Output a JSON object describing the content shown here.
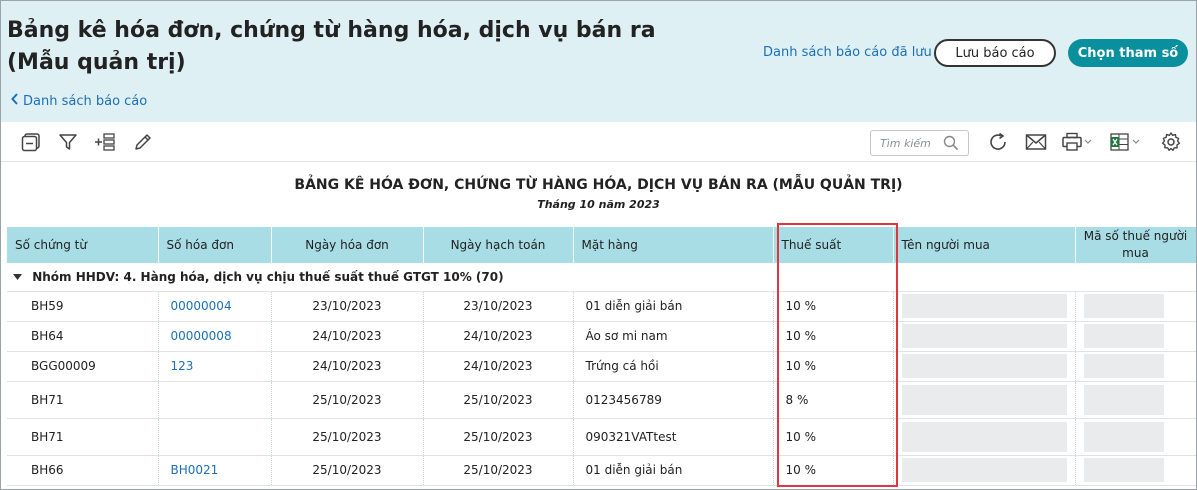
{
  "header": {
    "title_line1": "Bảng kê hóa đơn, chứng từ hàng hóa, dịch vụ bán ra",
    "title_line2": "(Mẫu quản trị)",
    "back_link": "Danh sách báo cáo",
    "saved_reports_link": "Danh sách báo cáo đã lưu",
    "save_button": "Lưu báo cáo",
    "params_button": "Chọn tham số"
  },
  "toolbar": {
    "search_placeholder": "Tìm kiếm",
    "icons": [
      "collapse-icon",
      "filter-icon",
      "add-row-icon",
      "edit-icon",
      "refresh-icon",
      "mail-icon",
      "print-icon",
      "excel-icon",
      "settings-icon"
    ]
  },
  "report": {
    "title": "BẢNG KÊ HÓA ĐƠN, CHỨNG TỪ HÀNG HÓA, DỊCH VỤ BÁN RA (MẪU QUẢN TRỊ)",
    "subtitle": "Tháng 10 năm 2023"
  },
  "table": {
    "columns": [
      "Số chứng từ",
      "Số hóa đơn",
      "Ngày hóa đơn",
      "Ngày hạch toán",
      "Mặt hàng",
      "Thuế suất",
      "Tên người mua",
      "Mã số thuế người mua"
    ],
    "group_label": "Nhóm HHDV: 4. Hàng hóa, dịch vụ chịu thuế suất thuế GTGT 10% (70)",
    "rows": [
      {
        "so_chung_tu": "BH59",
        "so_hoa_don": "00000004",
        "ngay_hoa_don": "23/10/2023",
        "ngay_hach_toan": "23/10/2023",
        "mat_hang": "01 diễn giải bán",
        "thue_suat": "10 %"
      },
      {
        "so_chung_tu": "BH64",
        "so_hoa_don": "00000008",
        "ngay_hoa_don": "24/10/2023",
        "ngay_hach_toan": "24/10/2023",
        "mat_hang": "Áo sơ mi nam",
        "thue_suat": "10 %"
      },
      {
        "so_chung_tu": "BGG00009",
        "so_hoa_don": "123",
        "ngay_hoa_don": "24/10/2023",
        "ngay_hach_toan": "24/10/2023",
        "mat_hang": "Trứng cá hồi",
        "thue_suat": "10 %"
      },
      {
        "so_chung_tu": "BH71",
        "so_hoa_don": "",
        "ngay_hoa_don": "25/10/2023",
        "ngay_hach_toan": "25/10/2023",
        "mat_hang": "0123456789",
        "thue_suat": "8 %"
      },
      {
        "so_chung_tu": "BH71",
        "so_hoa_don": "",
        "ngay_hoa_don": "25/10/2023",
        "ngay_hach_toan": "25/10/2023",
        "mat_hang": "090321VATtest",
        "thue_suat": "10 %"
      },
      {
        "so_chung_tu": "BH66",
        "so_hoa_don": "BH0021",
        "ngay_hoa_don": "25/10/2023",
        "ngay_hach_toan": "25/10/2023",
        "mat_hang": "01 diễn giải bán",
        "thue_suat": "10 %"
      }
    ]
  },
  "colors": {
    "header_bg": "#dff0f4",
    "table_header_bg": "#a8dde6",
    "accent": "#0a8f9e",
    "link": "#1b6fb5",
    "highlight": "#e0373f"
  }
}
